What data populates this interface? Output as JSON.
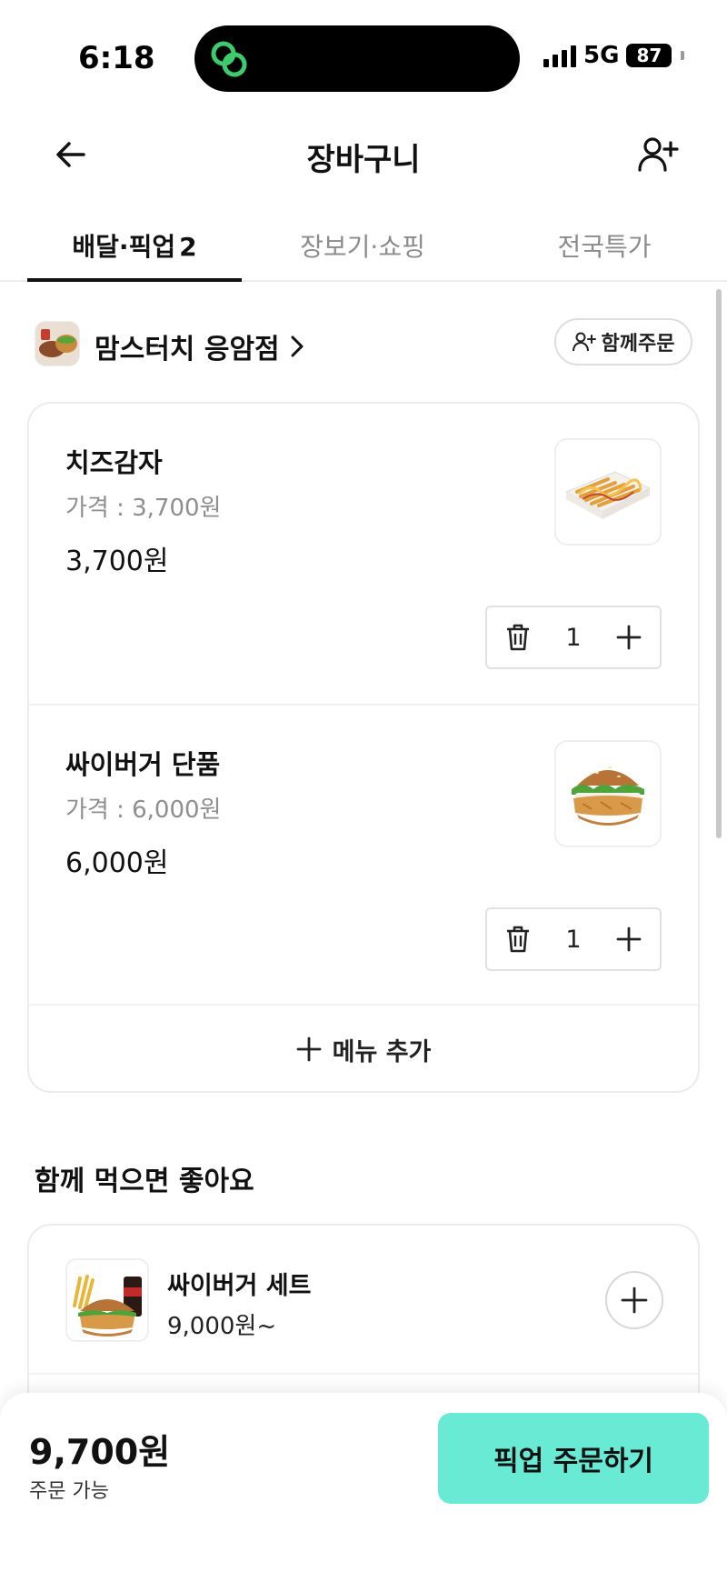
{
  "status_bar": {
    "time": "6:18",
    "network": "5G",
    "battery": "87",
    "dynamic_island_icon": "link-chain-icon",
    "icon_color": "#3ecb6e"
  },
  "header": {
    "title": "장바구니",
    "back_icon": "arrow-left-icon",
    "invite_icon": "person-add-icon"
  },
  "tabs": [
    {
      "label": "배달·픽업",
      "count": "2",
      "active": true
    },
    {
      "label": "장보기·쇼핑",
      "active": false
    },
    {
      "label": "전국특가",
      "active": false
    }
  ],
  "store": {
    "name": "맘스터치 응암점",
    "chevron_icon": "chevron-right-icon",
    "group_order_label": "함께주문",
    "group_order_icon": "person-add-icon"
  },
  "cart": {
    "items": [
      {
        "name": "치즈감자",
        "price_label": "가격 : 3,700원",
        "total": "3,700원",
        "quantity": "1",
        "image": "cheese-fries-image"
      },
      {
        "name": "싸이버거 단품",
        "price_label": "가격 : 6,000원",
        "total": "6,000원",
        "quantity": "1",
        "image": "chicken-burger-image"
      }
    ],
    "add_menu_label": "메뉴 추가"
  },
  "recommendations": {
    "title": "함께 먹으면 좋아요",
    "items": [
      {
        "name": "싸이버거 세트",
        "price": "9,000원~",
        "image": "burger-set-image"
      }
    ]
  },
  "bottom_bar": {
    "total": "9,700원",
    "status": "주문 가능",
    "order_button_label": "픽업 주문하기",
    "accent_color": "#68ead4"
  }
}
